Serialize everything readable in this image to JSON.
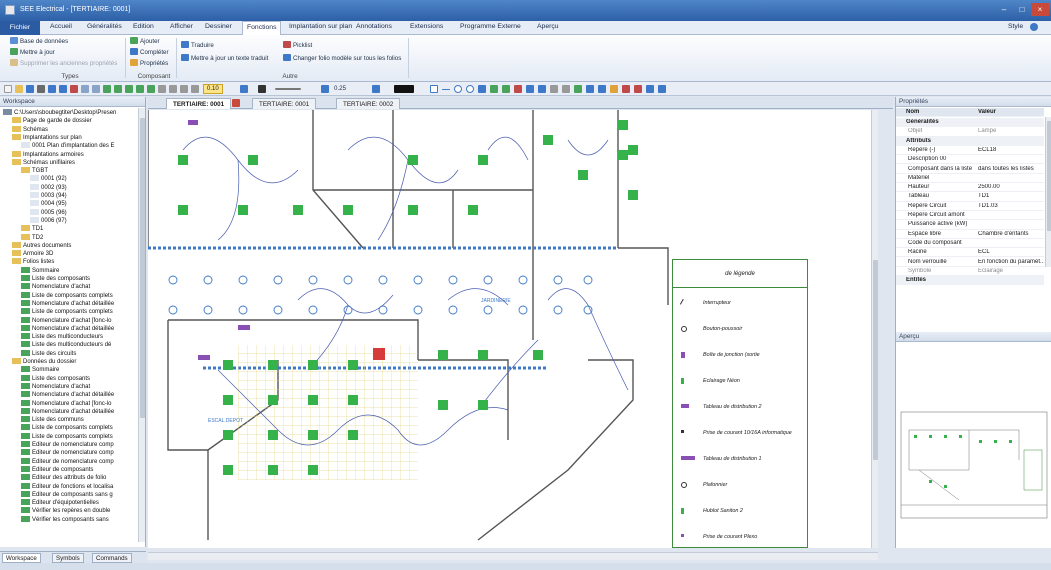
{
  "app": {
    "title": "SEE Electrical - [TERTIAIRE: 0001]"
  },
  "menu": {
    "items": [
      "Fichier",
      "Accueil",
      "Généralités",
      "Edition",
      "Afficher",
      "Dessiner",
      "Fonctions",
      "Implantation sur plan",
      "Annotations",
      "Extensions",
      "Programme Externe",
      "Aperçu"
    ],
    "active": "Fonctions",
    "style_label": "Style"
  },
  "ribbon": {
    "types": {
      "items": [
        "Base de données",
        "Mettre à jour",
        "Supprimer les anciennes propriétés"
      ],
      "group": "Types"
    },
    "composant": {
      "items": [
        "Ajouter",
        "Compléter",
        "Propriétés"
      ],
      "group": "Composant"
    },
    "traduire": "Traduire",
    "update_text": "Mettre à jour un texte traduit",
    "picklist": "Picklist",
    "change_folio": "Changer folio modèle sur tous les folios",
    "autre_group": "Autre"
  },
  "toolbar": {
    "zoom": "0.10",
    "line": "0.25"
  },
  "workspace": {
    "title": "Workspace",
    "tree": [
      {
        "d": 0,
        "t": "C:\\Users\\sboubegtiter\\Desktop\\Presen"
      },
      {
        "d": 1,
        "t": "Page de garde de dossier"
      },
      {
        "d": 1,
        "t": "Schémas"
      },
      {
        "d": 1,
        "t": "Implantations sur plan"
      },
      {
        "d": 2,
        "t": "0001 Plan d'implantation des E"
      },
      {
        "d": 1,
        "t": "Implantations armoires"
      },
      {
        "d": 1,
        "t": "Schémas unifilaires"
      },
      {
        "d": 2,
        "t": "TGBT"
      },
      {
        "d": 3,
        "t": "0001 (92)"
      },
      {
        "d": 3,
        "t": "0002 (93)"
      },
      {
        "d": 3,
        "t": "0003 (94)"
      },
      {
        "d": 3,
        "t": "0004 (95)"
      },
      {
        "d": 3,
        "t": "0005 (96)"
      },
      {
        "d": 3,
        "t": "0006 (97)"
      },
      {
        "d": 2,
        "t": "TD1"
      },
      {
        "d": 2,
        "t": "TD2"
      },
      {
        "d": 1,
        "t": "Autres documents"
      },
      {
        "d": 1,
        "t": "Armoire 3D"
      },
      {
        "d": 1,
        "t": "Folios listes"
      },
      {
        "d": 2,
        "t": "Sommaire"
      },
      {
        "d": 2,
        "t": "Liste des composants"
      },
      {
        "d": 2,
        "t": "Nomenclature d'achat"
      },
      {
        "d": 2,
        "t": "Liste de composants complets"
      },
      {
        "d": 2,
        "t": "Nomenclature d'achat détaillée"
      },
      {
        "d": 2,
        "t": "Liste de composants complets"
      },
      {
        "d": 2,
        "t": "Nomenclature d'achat [fonc-lo"
      },
      {
        "d": 2,
        "t": "Nomenclature d'achat détaillée"
      },
      {
        "d": 2,
        "t": "Liste des multiconducteurs"
      },
      {
        "d": 2,
        "t": "Liste des multiconducteurs dé"
      },
      {
        "d": 2,
        "t": "Liste des circuits"
      },
      {
        "d": 1,
        "t": "Données du dossier"
      },
      {
        "d": 2,
        "t": "Sommaire"
      },
      {
        "d": 2,
        "t": "Liste des composants"
      },
      {
        "d": 2,
        "t": "Nomenclature d'achat"
      },
      {
        "d": 2,
        "t": "Nomenclature d'achat détaillée"
      },
      {
        "d": 2,
        "t": "Nomenclature d'achat [fonc-lo"
      },
      {
        "d": 2,
        "t": "Nomenclature d'achat détaillée"
      },
      {
        "d": 2,
        "t": "Liste des communs"
      },
      {
        "d": 2,
        "t": "Liste de composants complets"
      },
      {
        "d": 2,
        "t": "Liste de composants complets"
      },
      {
        "d": 2,
        "t": "Editeur de nomenclature comp"
      },
      {
        "d": 2,
        "t": "Editeur de nomenclature comp"
      },
      {
        "d": 2,
        "t": "Editeur de nomenclature comp"
      },
      {
        "d": 2,
        "t": "Editeur de composants"
      },
      {
        "d": 2,
        "t": "Editeur des attributs de folio"
      },
      {
        "d": 2,
        "t": "Editeur de fonctions et localisa"
      },
      {
        "d": 2,
        "t": "Editeur de composants sans g"
      },
      {
        "d": 2,
        "t": "Editeur d'équipotentielles"
      },
      {
        "d": 2,
        "t": "Vérifier les repères en double"
      },
      {
        "d": 2,
        "t": "Vérifier les composants sans"
      }
    ],
    "bottom_tabs": [
      "Workspace",
      "Symbols",
      "Commands"
    ]
  },
  "doc_tabs": [
    "TERTIAIRE: 0001",
    "TERTIAIRE: 0001",
    "TERTIAIRE: 0002"
  ],
  "plan": {
    "room_labels": [
      "JARDINERIE",
      "ESCAL.DEPOT"
    ],
    "legend_title": "de légende",
    "legend": [
      "Interrupteur",
      "Bouton-poussoir",
      "Boîte de jonction (sortie",
      "Eclairage Néon",
      "Tableau de distribution 2",
      "Prise de courant 10/16A informatique",
      "Tableau de distribution 1",
      "Plafonnier",
      "Hublot Saniton 2",
      "Prise de courant Plexo"
    ]
  },
  "properties": {
    "title": "Propriétés",
    "col_name": "Nom",
    "col_value": "Valeur",
    "rows": [
      {
        "type": "cat",
        "k": "Généralités"
      },
      {
        "type": "gray",
        "k": "Objet",
        "v": "Lampe"
      },
      {
        "type": "cat",
        "k": "Attributs"
      },
      {
        "k": "Repère (-)",
        "v": "ECL18"
      },
      {
        "k": "Description 00",
        "v": ""
      },
      {
        "k": "Composant dans la liste",
        "v": "dans toutes les listes"
      },
      {
        "k": "Matériel",
        "v": ""
      },
      {
        "k": "Hauteur",
        "v": "2500.00"
      },
      {
        "k": "Tableau",
        "v": "TD1"
      },
      {
        "k": "Repère Circuit",
        "v": "TD1.03"
      },
      {
        "k": "Repère Circuit amont",
        "v": ""
      },
      {
        "k": "Puissance active (kW)",
        "v": ""
      },
      {
        "k": "Espace libre",
        "v": "Chambre d'enfants"
      },
      {
        "k": "Code du composant",
        "v": ""
      },
      {
        "k": "Racine",
        "v": "ECL"
      },
      {
        "k": "Nom verrouillé",
        "v": "En fonction du paramét..."
      },
      {
        "type": "gray",
        "k": "Symbole",
        "v": "Eclairage"
      },
      {
        "type": "cat",
        "k": "Entités"
      }
    ]
  },
  "apercu": {
    "title": "Aperçu"
  }
}
